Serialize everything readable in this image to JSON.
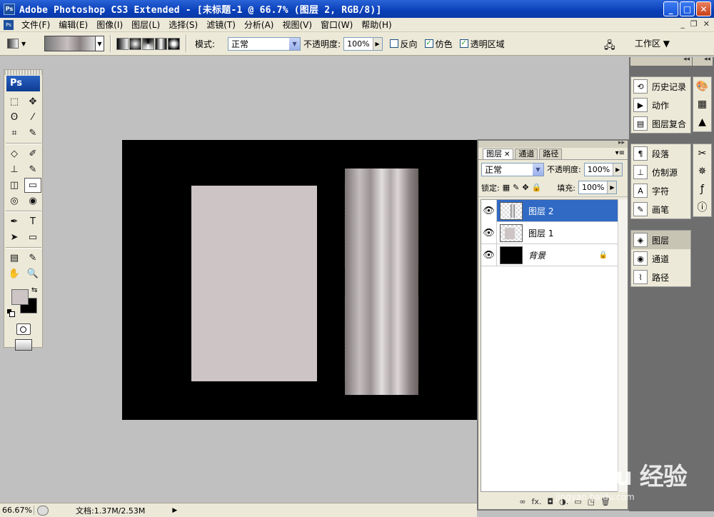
{
  "window": {
    "title": "Adobe Photoshop CS3 Extended - [未标题-1 @ 66.7% (图层 2, RGB/8)]",
    "ps_badge": "Ps",
    "min": "_",
    "max": "□",
    "close": "✕"
  },
  "menu": {
    "items": [
      "文件(F)",
      "编辑(E)",
      "图像(I)",
      "图层(L)",
      "选择(S)",
      "滤镜(T)",
      "分析(A)",
      "视图(V)",
      "窗口(W)",
      "帮助(H)"
    ],
    "doc_min": "_",
    "doc_restore": "❐",
    "doc_close": "✕"
  },
  "options": {
    "mode_label": "模式:",
    "mode_value": "正常",
    "opacity_label": "不透明度:",
    "opacity_value": "100%",
    "reverse_label": "反向",
    "dither_label": "仿色",
    "transparency_label": "透明区域",
    "workspace_label": "工作区 ▼"
  },
  "toolbox": {
    "logo": "Ps",
    "tools": [
      "⬚",
      "✥",
      "ʘ",
      "⁄",
      "⌗",
      "✎",
      "◇",
      "✐",
      "⊥",
      "✎",
      "◫",
      "▭",
      "◎",
      "◉",
      "✒",
      "T",
      "➤",
      "▭",
      "▤",
      "✎",
      "✋",
      "🔍"
    ]
  },
  "layers_panel": {
    "tabs": [
      "图层",
      "通道",
      "路径"
    ],
    "tab_close": "✕",
    "blend_mode": "正常",
    "opacity_label": "不透明度:",
    "opacity_value": "100%",
    "lock_label": "锁定:",
    "fill_label": "填充:",
    "fill_value": "100%",
    "layers": [
      {
        "name": "图层 2",
        "selected": true
      },
      {
        "name": "图层 1",
        "selected": false
      },
      {
        "name": "背景",
        "selected": false,
        "locked": true
      }
    ],
    "bottom_icons": [
      "∞",
      "fx.",
      "◘",
      "◑.",
      "▭",
      "◳",
      "🗑"
    ]
  },
  "dock": {
    "group1": [
      "历史记录",
      "动作",
      "图层复合"
    ],
    "group2": [
      "段落",
      "仿制源",
      "字符",
      "画笔"
    ],
    "group3": [
      "图层",
      "通道",
      "路径"
    ]
  },
  "status": {
    "zoom": "66.67%",
    "doc": "文档:1.37M/2.53M"
  },
  "watermark": {
    "brand": "Bai du 经验",
    "url": "jingyan.baidu.com"
  }
}
